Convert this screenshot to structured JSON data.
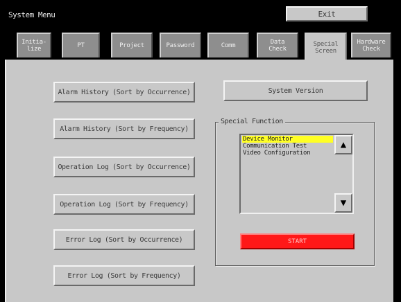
{
  "header": {
    "title": "System Menu",
    "exit_label": "Exit"
  },
  "tabs": [
    {
      "label": "Initia-\nlize"
    },
    {
      "label": "PT"
    },
    {
      "label": "Project"
    },
    {
      "label": "Password"
    },
    {
      "label": "Comm"
    },
    {
      "label": "Data\nCheck"
    },
    {
      "label": "Special\nScreen",
      "active": true
    },
    {
      "label": "Hardware\nCheck"
    }
  ],
  "left_buttons": [
    "Alarm History (Sort by Occurrence)",
    "Alarm History (Sort by Frequency)",
    "Operation Log (Sort by Occurrence)",
    "Operation Log (Sort by Frequency)",
    "Error Log (Sort by Occurrence)",
    "Error Log (Sort by Frequency)"
  ],
  "system_version_label": "System Version",
  "special_function": {
    "group_label": "Special Function",
    "items": [
      "Device Monitor",
      "Communication Test",
      "Video Configuration"
    ],
    "selected_index": 0,
    "up_icon": "up-arrow-icon",
    "down_icon": "down-arrow-icon",
    "start_label": "START"
  },
  "colors": {
    "panel": "#c8c8c8",
    "tab_inactive": "#8e8e8e",
    "selection": "#ffff24",
    "start": "#ff1818"
  }
}
